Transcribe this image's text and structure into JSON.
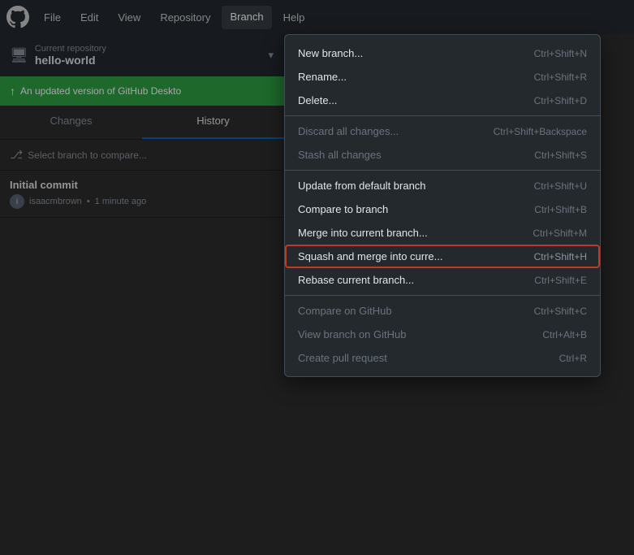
{
  "titleBar": {
    "menuItems": [
      {
        "id": "file",
        "label": "File",
        "active": false
      },
      {
        "id": "edit",
        "label": "Edit",
        "active": false
      },
      {
        "id": "view",
        "label": "View",
        "active": false
      },
      {
        "id": "repository",
        "label": "Repository",
        "active": false
      },
      {
        "id": "branch",
        "label": "Branch",
        "active": true
      },
      {
        "id": "help",
        "label": "Help",
        "active": false
      }
    ]
  },
  "repoBar": {
    "label": "Current repository",
    "name": "hello-world"
  },
  "updateBar": {
    "text": "An updated version of GitHub Deskto"
  },
  "tabs": [
    {
      "id": "changes",
      "label": "Changes",
      "active": false
    },
    {
      "id": "history",
      "label": "History",
      "active": true
    }
  ],
  "branchCompare": {
    "placeholder": "Select branch to compare..."
  },
  "commits": [
    {
      "title": "Initial commit",
      "author": "isaacmbrown",
      "time": "1 minute ago"
    }
  ],
  "dropdown": {
    "sections": [
      {
        "items": [
          {
            "id": "new-branch",
            "label": "New branch...",
            "shortcut": "Ctrl+Shift+N",
            "disabled": false,
            "highlighted": false
          },
          {
            "id": "rename",
            "label": "Rename...",
            "shortcut": "Ctrl+Shift+R",
            "disabled": false,
            "highlighted": false
          },
          {
            "id": "delete",
            "label": "Delete...",
            "shortcut": "Ctrl+Shift+D",
            "disabled": false,
            "highlighted": false
          }
        ]
      },
      {
        "items": [
          {
            "id": "discard-all",
            "label": "Discard all changes...",
            "shortcut": "Ctrl+Shift+Backspace",
            "disabled": true,
            "highlighted": false
          },
          {
            "id": "stash-all",
            "label": "Stash all changes",
            "shortcut": "Ctrl+Shift+S",
            "disabled": true,
            "highlighted": false
          }
        ]
      },
      {
        "items": [
          {
            "id": "update-default",
            "label": "Update from default branch",
            "shortcut": "Ctrl+Shift+U",
            "disabled": false,
            "highlighted": false
          },
          {
            "id": "compare-to",
            "label": "Compare to branch",
            "shortcut": "Ctrl+Shift+B",
            "disabled": false,
            "highlighted": false
          },
          {
            "id": "merge-into",
            "label": "Merge into current branch...",
            "shortcut": "Ctrl+Shift+M",
            "disabled": false,
            "highlighted": false
          },
          {
            "id": "squash-merge",
            "label": "Squash and merge into curre...",
            "shortcut": "Ctrl+Shift+H",
            "disabled": false,
            "highlighted": true
          },
          {
            "id": "rebase",
            "label": "Rebase current branch...",
            "shortcut": "Ctrl+Shift+E",
            "disabled": false,
            "highlighted": false
          }
        ]
      },
      {
        "items": [
          {
            "id": "compare-github",
            "label": "Compare on GitHub",
            "shortcut": "Ctrl+Shift+C",
            "disabled": true,
            "highlighted": false
          },
          {
            "id": "view-github",
            "label": "View branch on GitHub",
            "shortcut": "Ctrl+Alt+B",
            "disabled": true,
            "highlighted": false
          },
          {
            "id": "pull-request",
            "label": "Create pull request",
            "shortcut": "Ctrl+R",
            "disabled": true,
            "highlighted": false
          }
        ]
      }
    ]
  }
}
